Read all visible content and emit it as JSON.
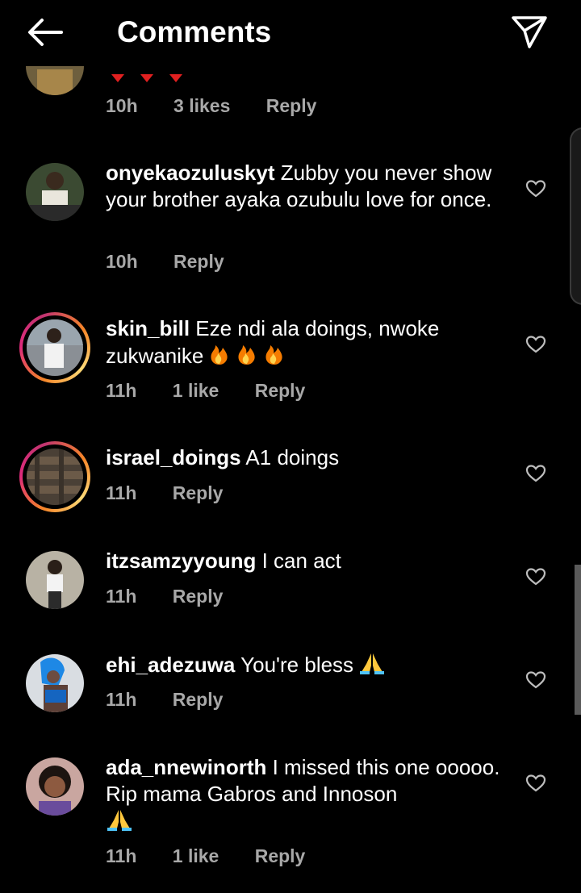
{
  "header": {
    "title": "Comments",
    "back_icon": "arrow-left-icon",
    "send_icon": "paper-plane-icon"
  },
  "colors": {
    "background": "#000000",
    "text": "#ffffff",
    "muted": "#a8a8a8"
  },
  "comments": [
    {
      "username": "",
      "text": "",
      "time": "10h",
      "likes": "3 likes",
      "reply": "Reply"
    },
    {
      "username": "onyekaozuluskyt",
      "text": "Zubby you never show your brother ayaka ozubulu love for once.",
      "time": "10h",
      "likes": "",
      "reply": "Reply"
    },
    {
      "username": "skin_bill",
      "text": "Eze ndi ala doings, nwoke zukwanike",
      "time": "11h",
      "likes": "1 like",
      "reply": "Reply"
    },
    {
      "username": "israel_doings",
      "text": "A1 doings",
      "time": "11h",
      "likes": "",
      "reply": "Reply"
    },
    {
      "username": "itzsamzyyoung",
      "text": "I can act",
      "time": "11h",
      "likes": "",
      "reply": "Reply"
    },
    {
      "username": "ehi_adezuwa",
      "text": "You're bless",
      "time": "11h",
      "likes": "",
      "reply": "Reply"
    },
    {
      "username": "ada_nnewinorth",
      "text": "I missed this one ooooo. Rip mama Gabros and Innoson",
      "time": "11h",
      "likes": "1 like",
      "reply": "Reply"
    }
  ]
}
